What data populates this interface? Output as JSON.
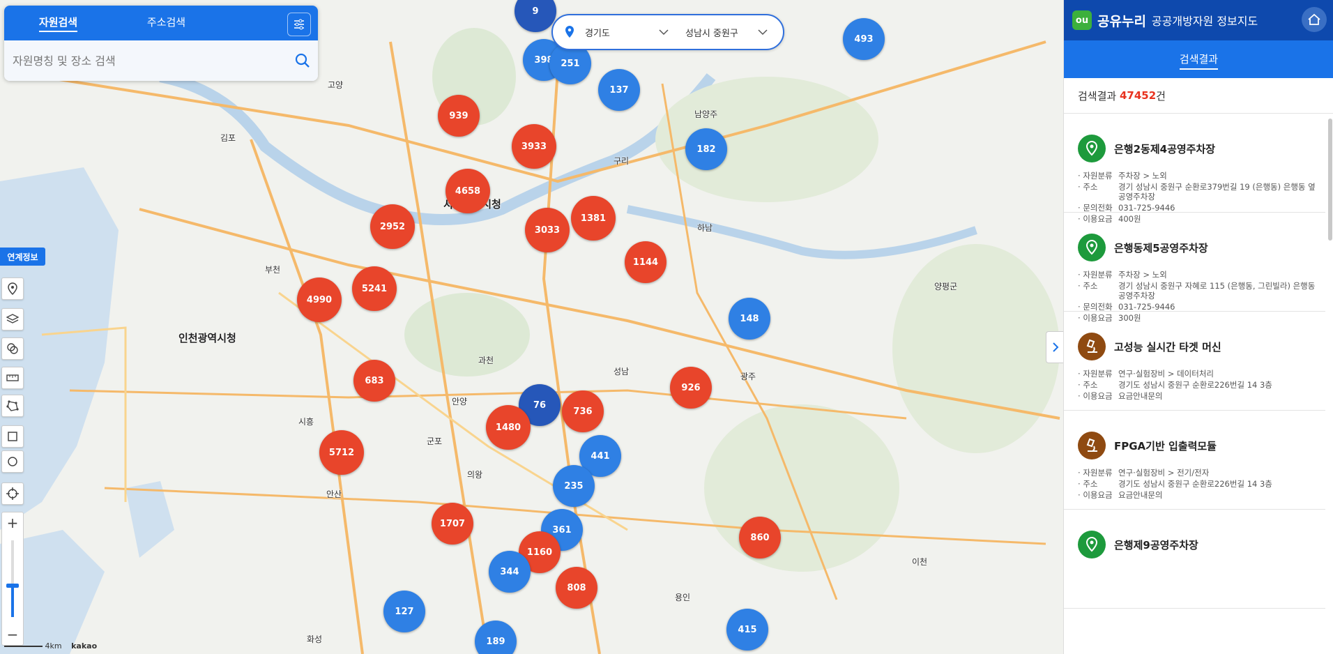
{
  "search": {
    "tabs": [
      "자원검색",
      "주소검색"
    ],
    "placeholder": "자원명칭 및 장소 검색"
  },
  "region": {
    "province": "경기도",
    "district": "성남시 중원구"
  },
  "tools": {
    "link_info": "연계정보",
    "scale": "4km",
    "map_brand": "kakao"
  },
  "map_labels": [
    "고양",
    "김포",
    "서울특별시청",
    "구리",
    "남양주",
    "하남",
    "부천",
    "인천광역시청",
    "과천",
    "안양",
    "성남",
    "광주",
    "군포",
    "시흥",
    "안산",
    "의왕",
    "용인",
    "화성",
    "이천",
    "양평군"
  ],
  "clusters": [
    {
      "value": "9",
      "color": "dark"
    },
    {
      "value": "398",
      "color": "blue"
    },
    {
      "value": "251",
      "color": "blue"
    },
    {
      "value": "137",
      "color": "blue"
    },
    {
      "value": "493",
      "color": "blue"
    },
    {
      "value": "939",
      "color": "red"
    },
    {
      "value": "3933",
      "color": "red"
    },
    {
      "value": "182",
      "color": "blue"
    },
    {
      "value": "4658",
      "color": "red"
    },
    {
      "value": "2952",
      "color": "red"
    },
    {
      "value": "3033",
      "color": "red"
    },
    {
      "value": "1381",
      "color": "red"
    },
    {
      "value": "1144",
      "color": "red"
    },
    {
      "value": "5241",
      "color": "red"
    },
    {
      "value": "4990",
      "color": "red"
    },
    {
      "value": "148",
      "color": "blue"
    },
    {
      "value": "683",
      "color": "red"
    },
    {
      "value": "926",
      "color": "red"
    },
    {
      "value": "76",
      "color": "dark"
    },
    {
      "value": "736",
      "color": "red"
    },
    {
      "value": "1480",
      "color": "red"
    },
    {
      "value": "5712",
      "color": "red"
    },
    {
      "value": "441",
      "color": "blue"
    },
    {
      "value": "235",
      "color": "blue"
    },
    {
      "value": "1707",
      "color": "red"
    },
    {
      "value": "361",
      "color": "blue"
    },
    {
      "value": "860",
      "color": "red"
    },
    {
      "value": "1160",
      "color": "red"
    },
    {
      "value": "344",
      "color": "blue"
    },
    {
      "value": "808",
      "color": "red"
    },
    {
      "value": "127",
      "color": "blue"
    },
    {
      "value": "415",
      "color": "blue"
    },
    {
      "value": "189",
      "color": "blue"
    }
  ],
  "panel": {
    "logo": "ou",
    "brand": "공유누리",
    "subtitle": "공공개방자원 정보지도",
    "tab": "검색결과",
    "count_label": "검색결과",
    "count": "47452",
    "count_unit": "건",
    "items": [
      {
        "title": "은행2동제4공영주차장",
        "icon": "location-pin-icon",
        "pin": "green",
        "rows": [
          [
            "자원분류",
            "주차장 > 노외"
          ],
          [
            "주소",
            "경기 성남시 중원구 순환로379번길 19 (은행동) 은행동 옆 공영주차장"
          ],
          [
            "문의전화",
            "031-725-9446"
          ],
          [
            "이용요금",
            "400원"
          ]
        ]
      },
      {
        "title": "은행동제5공영주차장",
        "icon": "location-pin-icon",
        "pin": "green",
        "rows": [
          [
            "자원분류",
            "주차장 > 노외"
          ],
          [
            "주소",
            "경기 성남시 중원구 자혜로 115 (은행동, 그린빌라) 은행동 공영주차장"
          ],
          [
            "문의전화",
            "031-725-9446"
          ],
          [
            "이용요금",
            "300원"
          ]
        ]
      },
      {
        "title": "고성능 실시간 타겟 머신",
        "icon": "microscope-icon",
        "pin": "brown",
        "rows": [
          [
            "자원분류",
            "연구·실험장비 > 데이터처리"
          ],
          [
            "주소",
            "경기도 성남시 중원구 순환로226번길 14 3층"
          ],
          [
            "이용요금",
            "요금안내문의"
          ]
        ]
      },
      {
        "title": "FPGA기반 입출력모듈",
        "icon": "microscope-icon",
        "pin": "brown",
        "rows": [
          [
            "자원분류",
            "연구·실험장비 > 전기/전자"
          ],
          [
            "주소",
            "경기도 성남시 중원구 순환로226번길 14 3층"
          ],
          [
            "이용요금",
            "요금안내문의"
          ]
        ]
      },
      {
        "title": "은행제9공영주차장",
        "icon": "location-pin-icon",
        "pin": "green",
        "rows": []
      }
    ]
  }
}
